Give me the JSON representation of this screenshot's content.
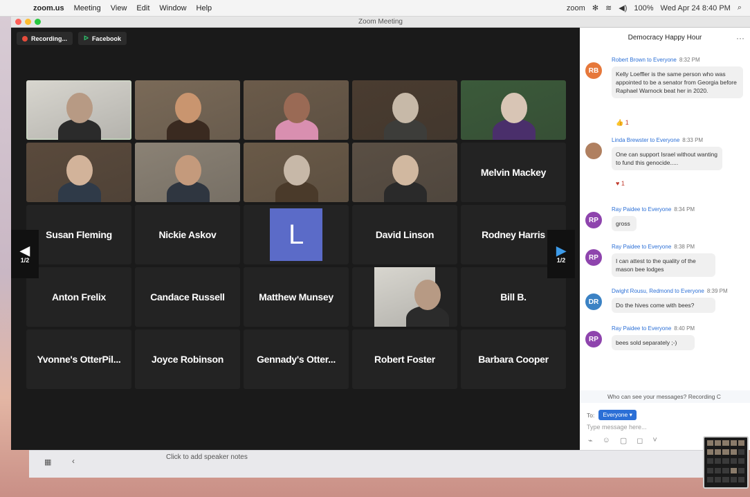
{
  "menubar": {
    "app": "zoom.us",
    "menus": [
      "Meeting",
      "View",
      "Edit",
      "Window",
      "Help"
    ],
    "zoom_label": "zoom",
    "battery": "100%",
    "datetime": "Wed Apr 24  8:40 PM"
  },
  "window": {
    "title": "Zoom Meeting"
  },
  "badges": {
    "recording": "Recording...",
    "facebook": "Facebook"
  },
  "tiles": [
    {
      "label": "",
      "video": true,
      "active": true
    },
    {
      "label": "",
      "video": true
    },
    {
      "label": "",
      "video": true
    },
    {
      "label": "",
      "video": true
    },
    {
      "label": "",
      "video": true
    },
    {
      "label": "",
      "video": true
    },
    {
      "label": "",
      "video": true
    },
    {
      "label": "",
      "video": true
    },
    {
      "label": "",
      "video": true
    },
    {
      "label": "Melvin Mackey"
    },
    {
      "label": "Susan Fleming"
    },
    {
      "label": "Nickie Askov"
    },
    {
      "label": "L",
      "avatar": true
    },
    {
      "label": "David Linson"
    },
    {
      "label": "Rodney Harris"
    },
    {
      "label": "Anton Frelix"
    },
    {
      "label": "Candace Russell"
    },
    {
      "label": "Matthew Munsey"
    },
    {
      "label": "",
      "video": true
    },
    {
      "label": "Bill B."
    },
    {
      "label": "Yvonne's OtterPil..."
    },
    {
      "label": "Joyce Robinson"
    },
    {
      "label": "Gennady's Otter..."
    },
    {
      "label": "Robert Foster"
    },
    {
      "label": "Barbara Cooper"
    }
  ],
  "nav": {
    "left_page": "1/2",
    "right_page": "1/2"
  },
  "chat": {
    "title": "Democracy Happy Hour",
    "messages": [
      {
        "initials": "RB",
        "color": "#e6783b",
        "from": "Robert Brown to Everyone",
        "time": "8:32 PM",
        "text": "Kelly Loeffler is the same person who was appointed to be a senator from Georgia before Raphael Warnock beat her in 2020.",
        "reaction": "👍 1"
      },
      {
        "initials": "",
        "color": "#b08060",
        "from": "Linda Brewster to Everyone",
        "time": "8:33 PM",
        "text": "One can support Israel without wanting to fund this genocide.....",
        "reaction": "♥ 1"
      },
      {
        "initials": "RP",
        "color": "#8e44ad",
        "from": "Ray Paidee to Everyone",
        "time": "8:34 PM",
        "text": "gross"
      },
      {
        "initials": "RP",
        "color": "#8e44ad",
        "from": "Ray Paidee to Everyone",
        "time": "8:38 PM",
        "text": "I can attest to the quality of the mason bee lodges"
      },
      {
        "initials": "DR",
        "color": "#3b82c4",
        "from": "Dwight Rousu, Redmond to Everyone",
        "time": "8:39 PM",
        "text": "Do the hives come with bees?"
      },
      {
        "initials": "RP",
        "color": "#8e44ad",
        "from": "Ray Paidee to Everyone",
        "time": "8:40 PM",
        "text": "bees sold separately ;-)"
      }
    ],
    "visibility_note": "Who can see your messages? Recording C",
    "to_label": "To:",
    "to_value": "Everyone ▾",
    "placeholder": "Type message here..."
  },
  "keynote": {
    "notes_placeholder": "Click to add speaker notes"
  }
}
